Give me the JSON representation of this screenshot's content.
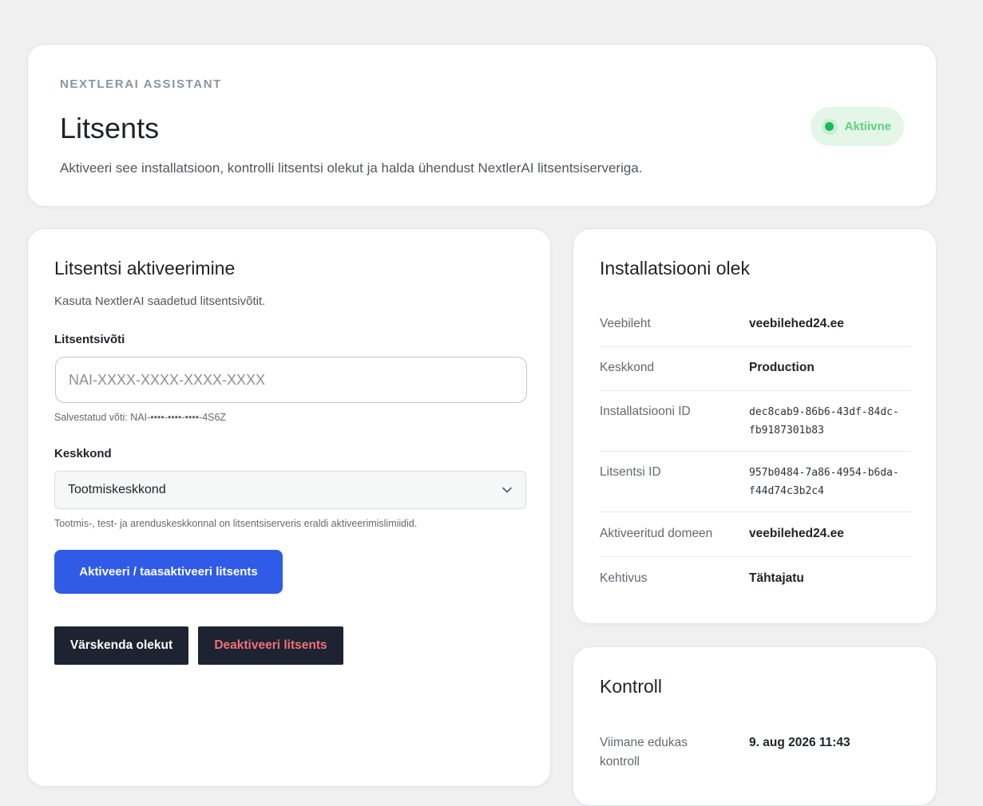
{
  "hero": {
    "eyebrow": "NEXTLERAI ASSISTANT",
    "title": "Litsents",
    "description": "Aktiveeri see installatsioon, kontrolli litsentsi olekut ja halda ühendust NextlerAI litsentsiserveriga.",
    "status": "Aktiivne"
  },
  "activation": {
    "title": "Litsentsi aktiveerimine",
    "subtitle": "Kasuta NextlerAI saadetud litsentsivõtit.",
    "key_label": "Litsentsivõti",
    "key_placeholder": "NAI-XXXX-XXXX-XXXX-XXXX",
    "key_value": "",
    "saved_key_note": "Salvestatud võti: NAI-••••-••••-••••-4S6Z",
    "env_label": "Keskkond",
    "env_selected": "Tootmiskeskkond",
    "env_help": "Tootmis-, test- ja arenduskeskkonnal on litsentsiserveris eraldi aktiveerimislimiidid.",
    "activate_button": "Aktiveeri / taasaktiveeri litsents",
    "refresh_button": "Värskenda olekut",
    "deactivate_button": "Deaktiveeri litsents"
  },
  "install": {
    "title": "Installatsiooni olek",
    "rows": [
      {
        "key": "Veebileht",
        "value": "veebilehed24.ee"
      },
      {
        "key": "Keskkond",
        "value": "Production"
      },
      {
        "key": "Installatsiooni ID",
        "value": "dec8cab9-86b6-43df-84dc-fb9187301b83"
      },
      {
        "key": "Litsentsi ID",
        "value": "957b0484-7a86-4954-b6da-f44d74c3b2c4"
      },
      {
        "key": "Aktiveeritud domeen",
        "value": "veebilehed24.ee"
      },
      {
        "key": "Kehtivus",
        "value": "Tähtajatu"
      }
    ]
  },
  "control": {
    "title": "Kontroll",
    "rows": [
      {
        "key": "Viimane edukas kontroll",
        "value": "9. aug 2026 11:43"
      }
    ]
  },
  "colors": {
    "accent": "#2f5be7",
    "dark_button": "#1d2330",
    "danger_text": "#f2707a",
    "status_green": "#1db954",
    "status_bg": "#e3f6e8"
  },
  "icons": {
    "select": "chevron-down-icon",
    "status": "status-dot-icon"
  }
}
